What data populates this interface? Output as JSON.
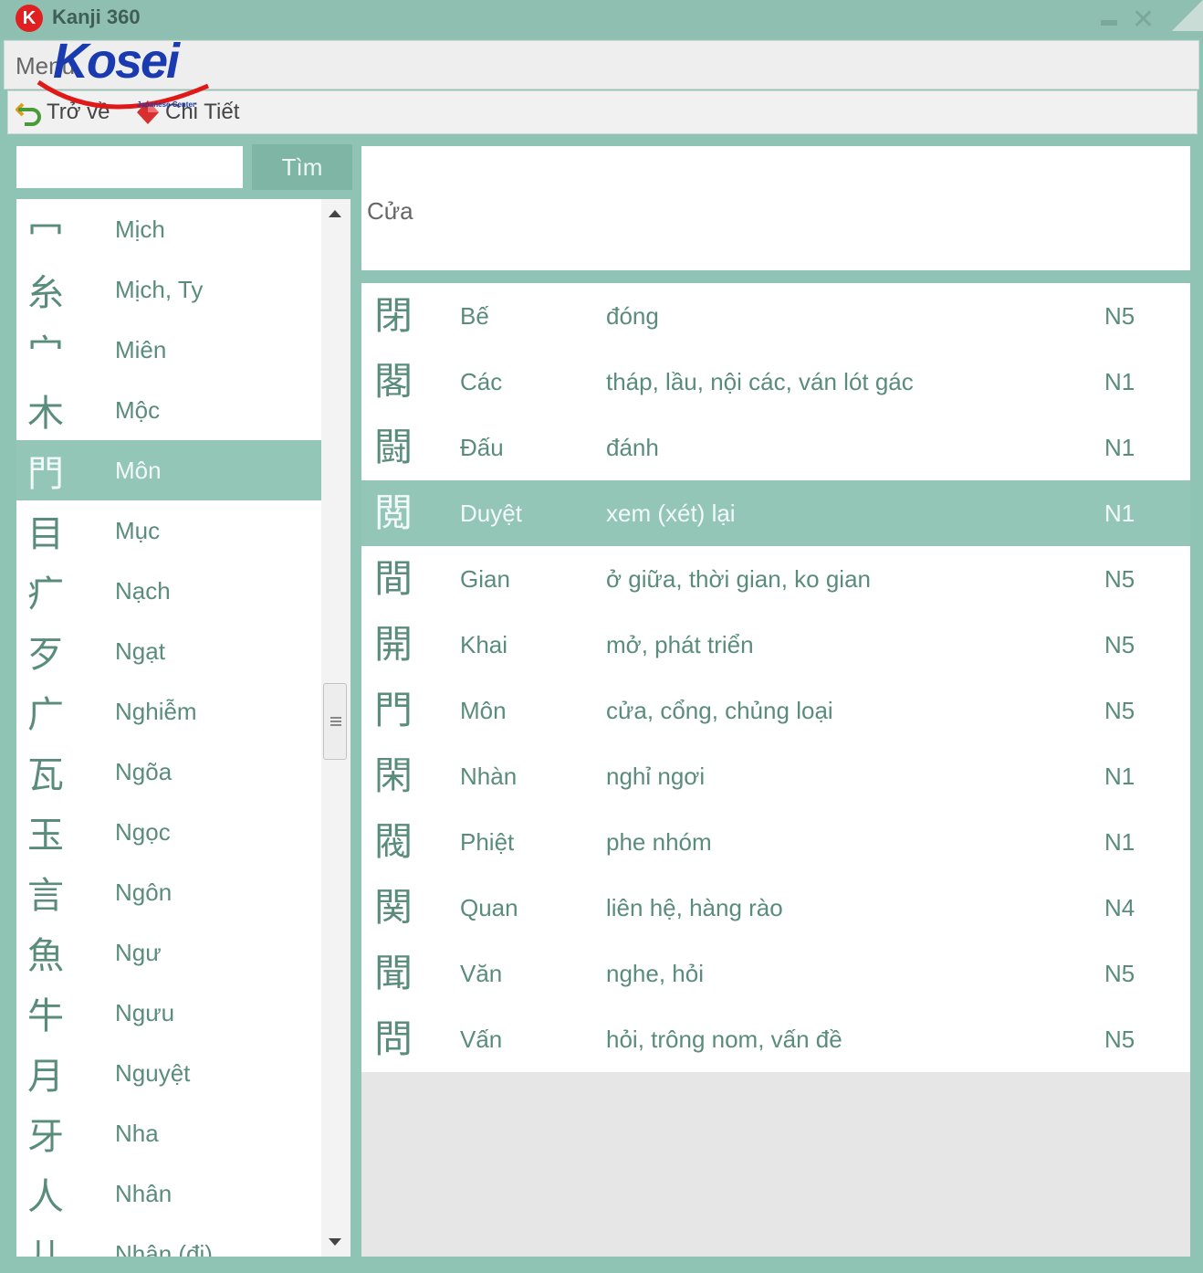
{
  "window": {
    "title": "Kanji 360",
    "icon_letter": "K"
  },
  "menu": {
    "label": "Menu"
  },
  "toolbar": {
    "back_label": "Trở về",
    "detail_label": "Chi Tiết"
  },
  "logo": {
    "text": "Kosei",
    "subtitle": "Japanese Center"
  },
  "search": {
    "value": "",
    "button_label": "Tìm"
  },
  "radicals": [
    {
      "char": "冖",
      "name": "Mịch"
    },
    {
      "char": "糸",
      "name": "Mịch, Ty"
    },
    {
      "char": "宀",
      "name": "Miên"
    },
    {
      "char": "木",
      "name": "Mộc"
    },
    {
      "char": "門",
      "name": "Môn",
      "selected": true
    },
    {
      "char": "目",
      "name": "Mục"
    },
    {
      "char": "疒",
      "name": "Nạch"
    },
    {
      "char": "歹",
      "name": "Ngạt"
    },
    {
      "char": "广",
      "name": "Nghiễm"
    },
    {
      "char": "瓦",
      "name": "Ngõa"
    },
    {
      "char": "玉",
      "name": "Ngọc"
    },
    {
      "char": "言",
      "name": "Ngôn"
    },
    {
      "char": "魚",
      "name": "Ngư"
    },
    {
      "char": "牛",
      "name": "Ngưu"
    },
    {
      "char": "月",
      "name": "Nguyệt"
    },
    {
      "char": "牙",
      "name": "Nha"
    },
    {
      "char": "人",
      "name": "Nhân"
    },
    {
      "char": "儿",
      "name": "Nhân (đi)"
    }
  ],
  "meaning": {
    "text": "Cửa"
  },
  "kanji_rows": [
    {
      "char": "閉",
      "reading": "Bế",
      "meaning": "đóng",
      "level": "N5"
    },
    {
      "char": "閣",
      "reading": "Các",
      "meaning": "tháp, lầu, nội các, ván lót gác",
      "level": "N1"
    },
    {
      "char": "闘",
      "reading": "Đấu",
      "meaning": "đánh",
      "level": "N1"
    },
    {
      "char": "閲",
      "reading": "Duyệt",
      "meaning": "xem (xét) lại",
      "level": "N1",
      "selected": true
    },
    {
      "char": "間",
      "reading": "Gian",
      "meaning": "ở giữa, thời gian, ko gian",
      "level": "N5"
    },
    {
      "char": "開",
      "reading": "Khai",
      "meaning": "mở, phát triển",
      "level": "N5"
    },
    {
      "char": "門",
      "reading": "Môn",
      "meaning": "cửa, cổng, chủng loại",
      "level": "N5"
    },
    {
      "char": "閑",
      "reading": "Nhàn",
      "meaning": "nghỉ ngơi",
      "level": "N1"
    },
    {
      "char": "閥",
      "reading": "Phiệt",
      "meaning": "phe nhóm",
      "level": "N1"
    },
    {
      "char": "関",
      "reading": "Quan",
      "meaning": "liên hệ, hàng rào",
      "level": "N4"
    },
    {
      "char": "聞",
      "reading": "Văn",
      "meaning": "nghe, hỏi",
      "level": "N5"
    },
    {
      "char": "問",
      "reading": "Vấn",
      "meaning": "hỏi, trông nom, vấn đề",
      "level": "N5"
    }
  ],
  "colors": {
    "accent": "#8fc3b3",
    "selected_row": "#93c6b6",
    "text": "#5a8c7c",
    "logo_blue": "#1a3bb0",
    "logo_red": "#e01818"
  }
}
